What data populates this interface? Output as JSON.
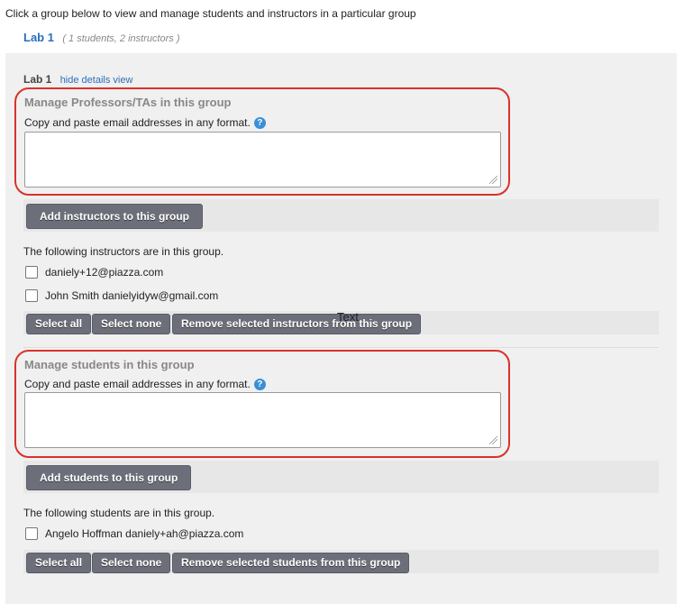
{
  "intro": "Click a group below to view and manage students and instructors in a particular group",
  "group": {
    "name": "Lab 1",
    "meta": "( 1 students, 2 instructors )"
  },
  "panel": {
    "title": "Lab 1",
    "hide_link": "hide details view",
    "instructors": {
      "manage_title": "Manage Professors/TAs in this group",
      "help_text": "Copy and paste email addresses in any format.",
      "help_icon": "?",
      "textarea_value": "",
      "add_button": "Add instructors to this group",
      "list_caption": "The following instructors are in this group.",
      "people": [
        "daniely+12@piazza.com",
        "John Smith danielyidyw@gmail.com"
      ],
      "select_all": "Select all",
      "select_none": "Select none",
      "remove_button": "Remove selected instructors from this group"
    },
    "students": {
      "manage_title": "Manage students in this group",
      "help_text": "Copy and paste email addresses in any format.",
      "help_icon": "?",
      "textarea_value": "",
      "add_button": "Add students to this group",
      "list_caption": "The following students are in this group.",
      "people": [
        "Angelo Hoffman daniely+ah@piazza.com"
      ],
      "select_all": "Select all",
      "select_none": "Select none",
      "remove_button": "Remove selected students from this group"
    }
  },
  "overlay_text": "Text",
  "colors": {
    "link": "#2a6ebb",
    "highlight": "#d9322a",
    "button": "#6c6f7a",
    "panel": "#f0f0f0"
  }
}
